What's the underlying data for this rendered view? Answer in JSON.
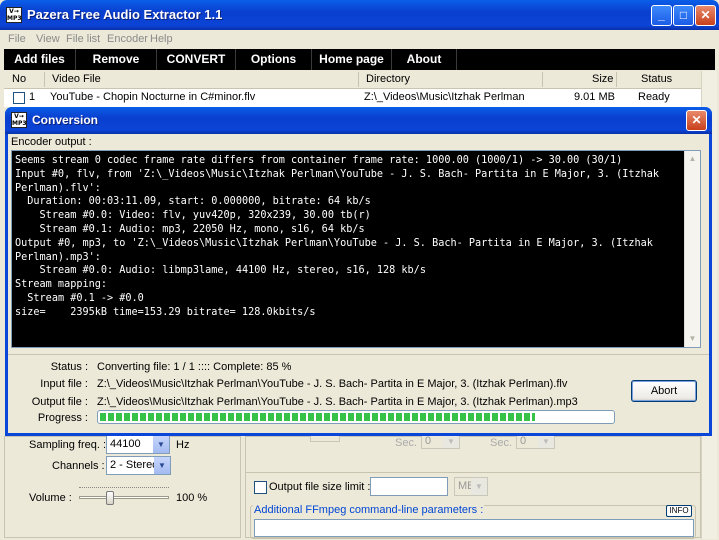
{
  "window": {
    "title": "Pazera Free Audio Extractor 1.1",
    "icon_text": "V→ MP3"
  },
  "menu": [
    "File",
    "View",
    "File list",
    "Encoder",
    "Help"
  ],
  "toolbar": [
    "Add files",
    "Remove",
    "CONVERT",
    "Options",
    "Home page",
    "About"
  ],
  "file_list": {
    "columns": [
      "No",
      "Video File",
      "Directory",
      "Size",
      "Status"
    ],
    "rows": [
      {
        "no": "1",
        "file": "YouTube - Chopin Nocturne in C#minor.flv",
        "dir": "Z:\\_Videos\\Music\\Itzhak Perlman",
        "size": "9.01 MB",
        "status": "Ready"
      }
    ]
  },
  "settings": {
    "sampling_label": "Sampling freq. :",
    "sampling_value": "44100",
    "sampling_unit": "Hz",
    "channels_label": "Channels :",
    "channels_value": "2 - Stereo",
    "volume_label": "Volume :",
    "volume_value": "100 %",
    "sec1_label": "Sec. :",
    "sec1_value": "0",
    "sec2_label": "Sec. :",
    "sec2_value": "0",
    "size_limit_label": "Output file size limit :",
    "size_limit_unit": "MB",
    "ffmpeg_params_label": "Additional FFmpeg command-line parameters :",
    "info_button": "INFO"
  },
  "dialog": {
    "title": "Conversion",
    "encoder_label": "Encoder output :",
    "console": "Seems stream 0 codec frame rate differs from container frame rate: 1000.00 (1000/1) -> 30.00 (30/1)\nInput #0, flv, from 'Z:\\_Videos\\Music\\Itzhak Perlman\\YouTube - J. S. Bach- Partita in E Major, 3. (Itzhak Perlman).flv':\n  Duration: 00:03:11.09, start: 0.000000, bitrate: 64 kb/s\n    Stream #0.0: Video: flv, yuv420p, 320x239, 30.00 tb(r)\n    Stream #0.1: Audio: mp3, 22050 Hz, mono, s16, 64 kb/s\nOutput #0, mp3, to 'Z:\\_Videos\\Music\\Itzhak Perlman\\YouTube - J. S. Bach- Partita in E Major, 3. (Itzhak Perlman).mp3':\n    Stream #0.0: Audio: libmp3lame, 44100 Hz, stereo, s16, 128 kb/s\nStream mapping:\n  Stream #0.1 -> #0.0\nsize=    2395kB time=153.29 bitrate= 128.0kbits/s",
    "status_label": "Status :",
    "status_value": "Converting file: 1 / 1 ::::  Complete: 85 %",
    "input_label": "Input file :",
    "input_value": "Z:\\_Videos\\Music\\Itzhak Perlman\\YouTube - J. S. Bach- Partita in E Major, 3. (Itzhak Perlman).flv",
    "output_label": "Output file :",
    "output_value": "Z:\\_Videos\\Music\\Itzhak Perlman\\YouTube - J. S. Bach- Partita in E Major, 3. (Itzhak Perlman).mp3",
    "progress_label": "Progress :",
    "progress_fraction": 0.85,
    "abort_label": "Abort"
  },
  "colors": {
    "titlebar": "#0a46d8",
    "console_bg": "#000000",
    "progress": "#37c24a",
    "toolbar": "#000000"
  }
}
